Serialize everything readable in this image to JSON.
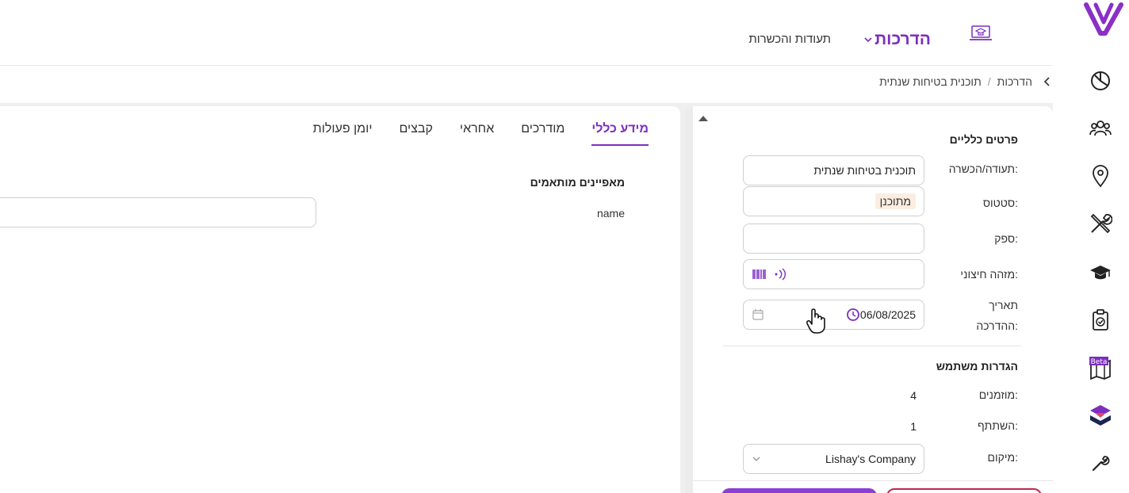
{
  "brand": {
    "accent": "#7b2fbf",
    "danger": "#c02a4a"
  },
  "rail": {
    "items": [
      {
        "icon": "chart-icon"
      },
      {
        "icon": "users-icon"
      },
      {
        "icon": "location-icon"
      },
      {
        "icon": "tools-icon"
      },
      {
        "icon": "graduation-cap-icon"
      },
      {
        "icon": "clipboard-check-icon"
      },
      {
        "icon": "map-beta-icon",
        "badge": "Beta"
      },
      {
        "icon": "layers-logo-icon"
      },
      {
        "icon": "wrench-icon"
      }
    ]
  },
  "topnav": {
    "active_label": "הדרכות",
    "item_label": "תעודות והכשרות"
  },
  "breadcrumb": {
    "root": "הדרכות",
    "separator": "/",
    "current": "תוכנית בטיחות שנתית"
  },
  "general": {
    "title": "פרטים כלליים",
    "cert_label": "תעודה/הכשרה:",
    "cert_value": "תוכנית בטיחות שנתית",
    "status_label": "סטטוס:",
    "status_value": "מתוכנן",
    "supplier_label": "ספק:",
    "supplier_value": "",
    "external_id_label": "מזהה חיצוני:",
    "external_id_value": "",
    "date_label_1": "תאריך",
    "date_label_2": "ההדרכה:",
    "date_value": "06/08/2025"
  },
  "user_settings": {
    "title": "הגדרות משתמש",
    "invited_label": "מוזמנים:",
    "invited_value": "4",
    "participated_label": "השתתף:",
    "participated_value": "1",
    "location_label": "מיקום:",
    "location_value": "Lishay's Company"
  },
  "tabs": [
    {
      "label": "מידע כללי",
      "active": true
    },
    {
      "label": "מודרכים",
      "active": false
    },
    {
      "label": "אחראי",
      "active": false
    },
    {
      "label": "קבצים",
      "active": false
    },
    {
      "label": "יומן פעולות",
      "active": false
    }
  ],
  "custom": {
    "title": "מאפיינים מותאמים",
    "field_label": "name",
    "field_value": ""
  }
}
